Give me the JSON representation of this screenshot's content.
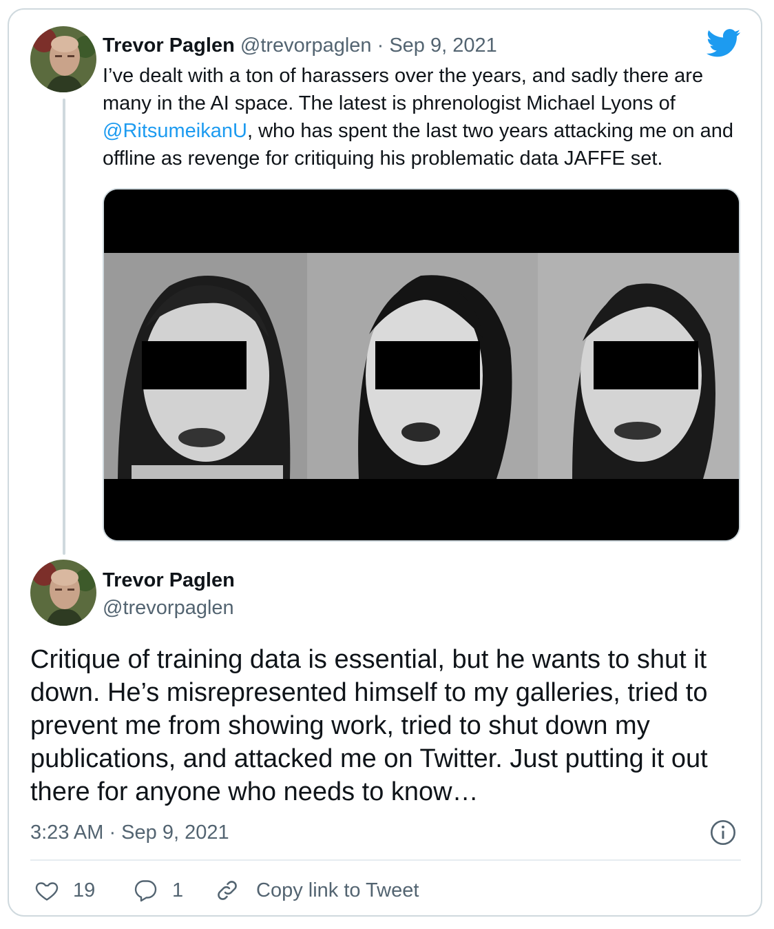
{
  "quoted_tweet": {
    "author_name": "Trevor Paglen",
    "author_handle": "@trevorpaglen",
    "separator": "·",
    "date": "Sep 9, 2021",
    "text_before_mention": "I’ve dealt with a ton of harassers over the years, and sadly there are many in the AI space. The latest is phrenologist Michael Lyons of ",
    "mention": "@RitsumeikanU",
    "text_after_mention": ", who has spent the last two years attacking me on and offline as revenge for critiquing his problematic data JAFFE set."
  },
  "main_tweet": {
    "author_name": "Trevor Paglen",
    "author_handle": "@trevorpaglen",
    "text": "Critique of training data is essential, but he wants to shut it down. He’s misrepresented himself to my galleries, tried to prevent me from showing work, tried to shut down my publications, and attacked me on Twitter. Just putting it out there for anyone who needs to know…",
    "timestamp": "3:23 AM · Sep 9, 2021"
  },
  "actions": {
    "like_count": "19",
    "reply_count": "1",
    "copy_link_label": "Copy link to Tweet"
  },
  "colors": {
    "brand_blue": "#1d9bf0",
    "text_primary": "#0f1419",
    "text_secondary": "#536471",
    "border": "#cfd9de"
  },
  "icons": [
    "twitter-bird-icon",
    "info-icon",
    "heart-icon",
    "reply-bubble-icon",
    "link-icon"
  ]
}
